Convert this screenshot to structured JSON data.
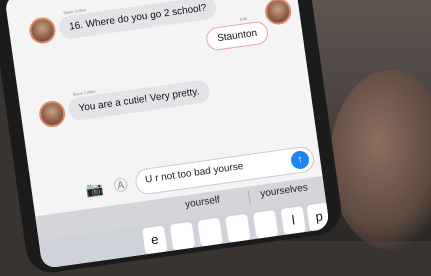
{
  "conversation": {
    "messages": [
      {
        "direction": "incoming",
        "sender": "Steve Coffen",
        "text": "16. Where do you go 2 school?"
      },
      {
        "direction": "outgoing",
        "sender": "KIM",
        "text": "Staunton"
      },
      {
        "direction": "incoming",
        "sender": "Steve Coffen",
        "text": "You are a cutie! Very pretty."
      }
    ]
  },
  "compose": {
    "draft": "U r not too bad yourse",
    "send_icon": "↑",
    "camera_icon": "camera-icon",
    "apps_icon": "app-store-icon"
  },
  "suggestions": [
    "yourself",
    "yourselves"
  ],
  "keyboard": {
    "visible_keys": [
      "e",
      "l",
      "p"
    ]
  },
  "colors": {
    "send_button": "#1e84f6",
    "incoming_bubble": "#e4e4e8",
    "outgoing_border": "#e7a3a3",
    "avatar_ring": "#d88a6a"
  }
}
